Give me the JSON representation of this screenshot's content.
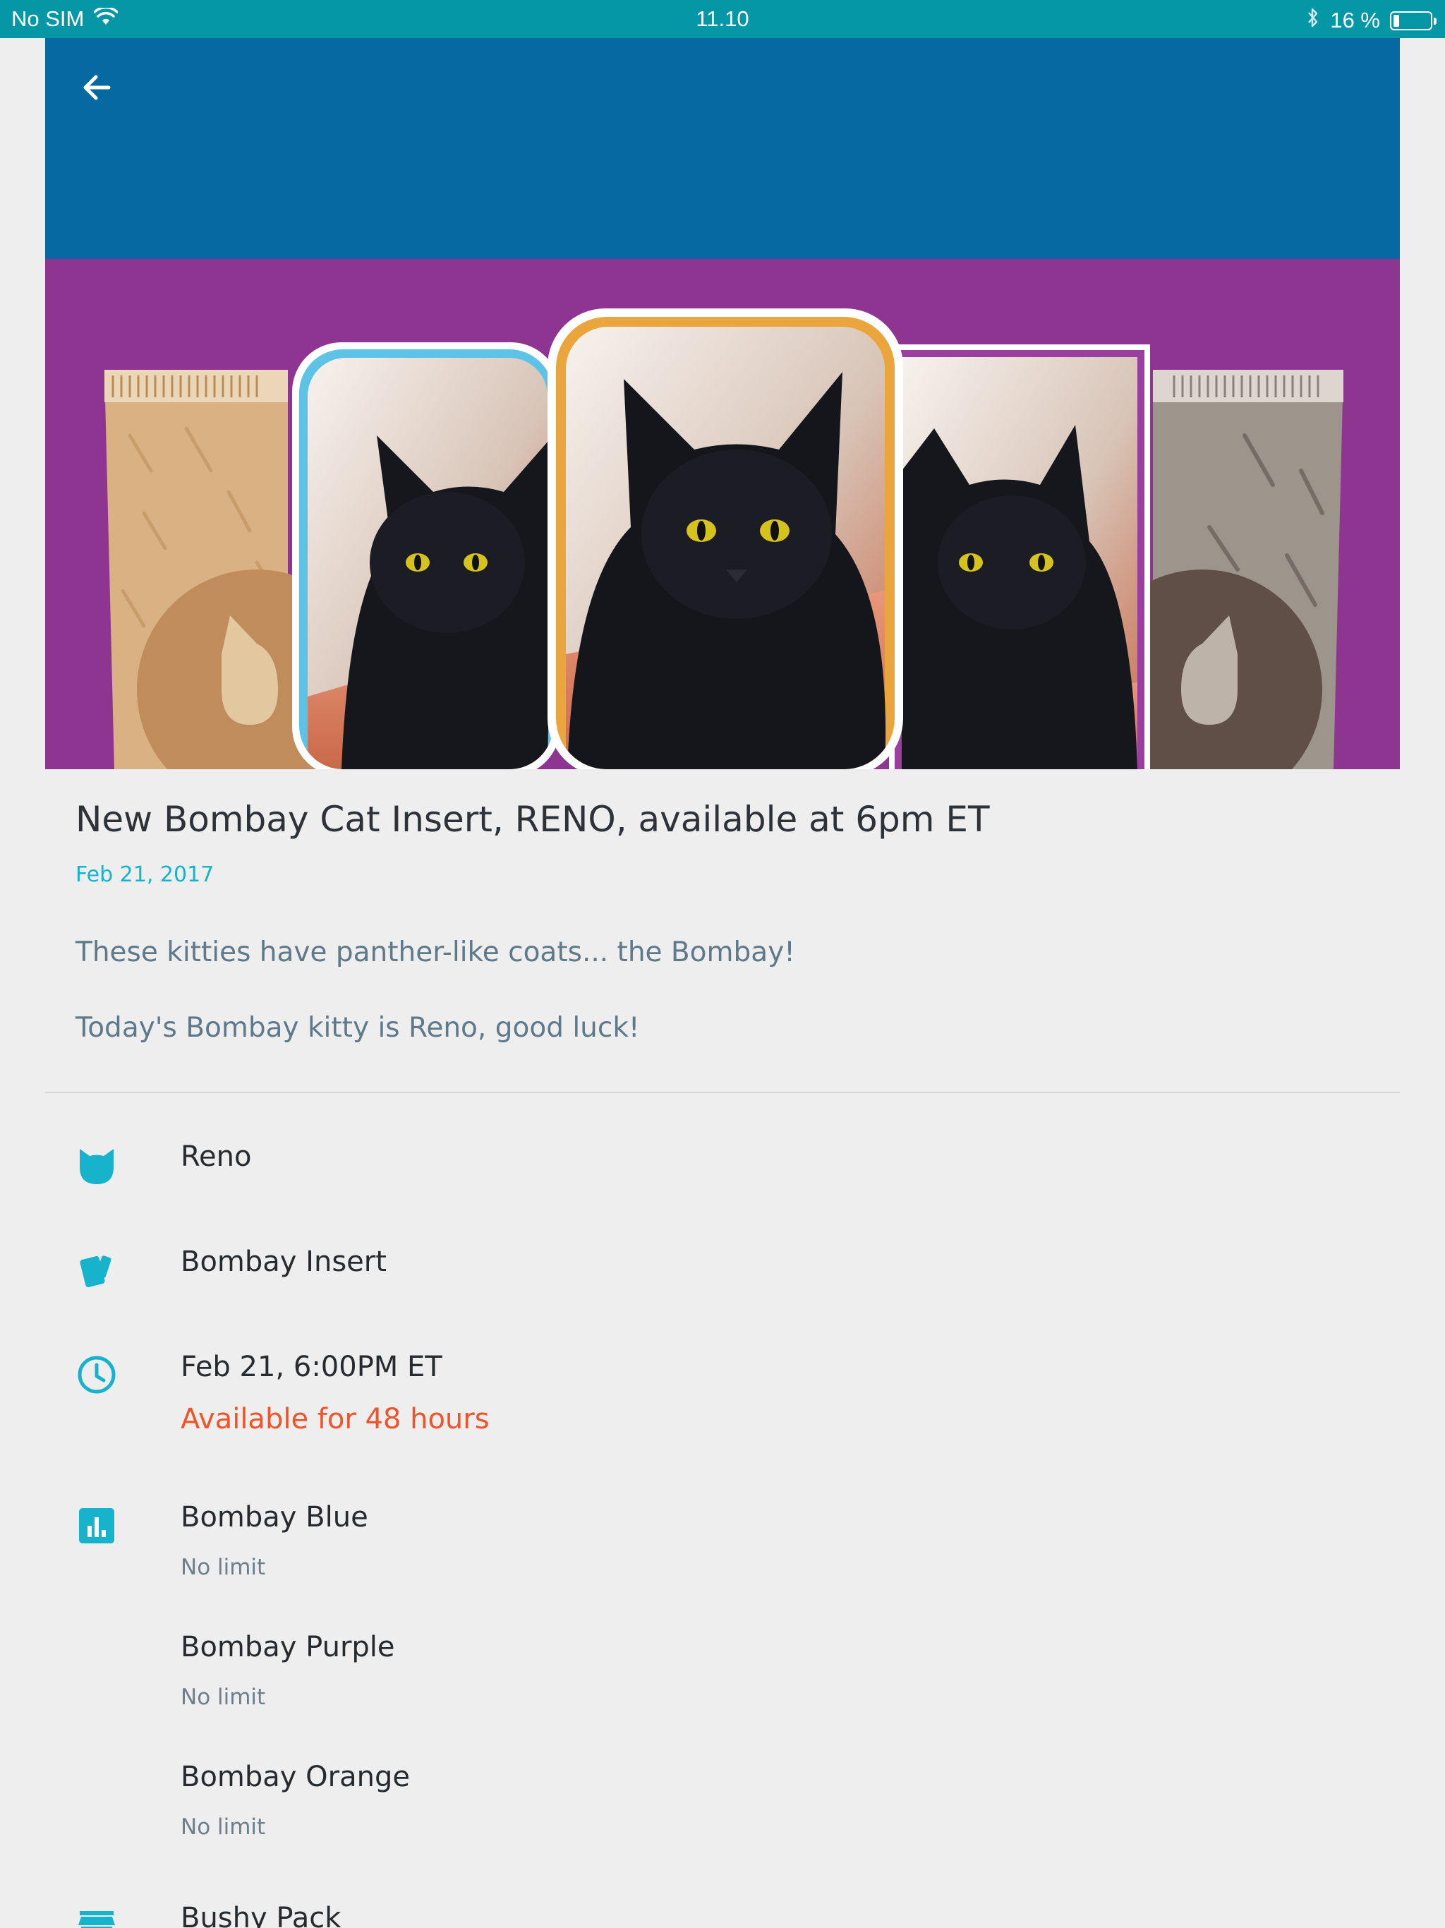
{
  "status_bar": {
    "carrier": "No SIM",
    "time": "11.10",
    "battery_text": "16 %",
    "battery_level": 0.16
  },
  "colors": {
    "status_bar": "#0597a6",
    "app_bar": "#0669a1",
    "hero_background": "#8d3591",
    "accent": "#17b3cc",
    "alert": "#f0542a"
  },
  "icons": {
    "back": "arrow-left-icon",
    "cat": "cat-face-icon",
    "cards": "cards-icon",
    "time": "clock-icon",
    "limits": "bar-chart-icon",
    "pack": "store-icon"
  },
  "article": {
    "title": "New Bombay Cat Insert, RENO, available at 6pm ET",
    "date": "Feb 21, 2017",
    "paragraphs": [
      "These kitties have panther-like coats... the Bombay!",
      "Today's Bombay kitty is Reno, good luck!"
    ]
  },
  "details": {
    "cat_name": "Reno",
    "insert_name": "Bombay Insert",
    "release_time": "Feb 21, 6:00PM ET",
    "availability": "Available for 48 hours",
    "variants": [
      {
        "name": "Bombay Blue",
        "limit": "No limit"
      },
      {
        "name": "Bombay Purple",
        "limit": "No limit"
      },
      {
        "name": "Bombay Orange",
        "limit": "No limit"
      }
    ],
    "pack_name": "Bushy Pack"
  }
}
